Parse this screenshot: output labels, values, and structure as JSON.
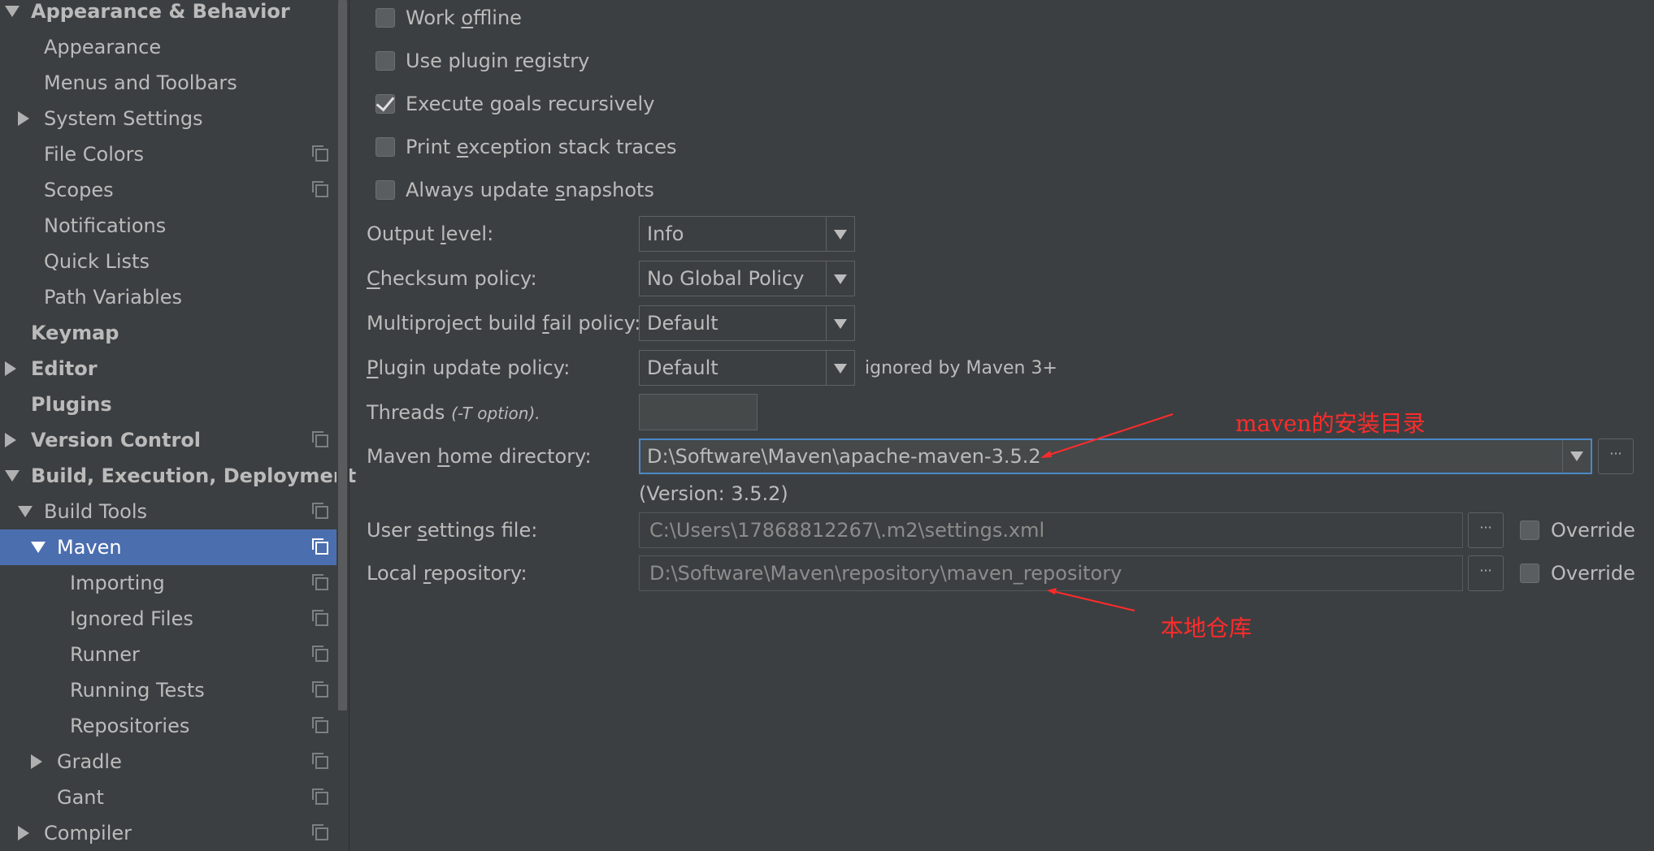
{
  "sidebar": {
    "items": [
      {
        "label": "Appearance & Behavior",
        "bold": true,
        "arrow": "down",
        "level": 0,
        "icon": false
      },
      {
        "label": "Appearance",
        "bold": false,
        "arrow": "",
        "level": 1,
        "icon": false
      },
      {
        "label": "Menus and Toolbars",
        "bold": false,
        "arrow": "",
        "level": 1,
        "icon": false
      },
      {
        "label": "System Settings",
        "bold": false,
        "arrow": "right",
        "level": 1,
        "icon": false
      },
      {
        "label": "File Colors",
        "bold": false,
        "arrow": "",
        "level": 1,
        "icon": true
      },
      {
        "label": "Scopes",
        "bold": false,
        "arrow": "",
        "level": 1,
        "icon": true
      },
      {
        "label": "Notifications",
        "bold": false,
        "arrow": "",
        "level": 1,
        "icon": false
      },
      {
        "label": "Quick Lists",
        "bold": false,
        "arrow": "",
        "level": 1,
        "icon": false
      },
      {
        "label": "Path Variables",
        "bold": false,
        "arrow": "",
        "level": 1,
        "icon": false
      },
      {
        "label": "Keymap",
        "bold": true,
        "arrow": "",
        "level": 0,
        "icon": false
      },
      {
        "label": "Editor",
        "bold": true,
        "arrow": "right",
        "level": 0,
        "icon": false
      },
      {
        "label": "Plugins",
        "bold": true,
        "arrow": "",
        "level": 0,
        "icon": false
      },
      {
        "label": "Version Control",
        "bold": true,
        "arrow": "right",
        "level": 0,
        "icon": true
      },
      {
        "label": "Build, Execution, Deployment",
        "bold": true,
        "arrow": "down",
        "level": 0,
        "icon": false
      },
      {
        "label": "Build Tools",
        "bold": false,
        "arrow": "down",
        "level": 1,
        "icon": true
      },
      {
        "label": "Maven",
        "bold": false,
        "arrow": "down",
        "level": 2,
        "icon": true,
        "selected": true
      },
      {
        "label": "Importing",
        "bold": false,
        "arrow": "",
        "level": 3,
        "icon": true
      },
      {
        "label": "Ignored Files",
        "bold": false,
        "arrow": "",
        "level": 3,
        "icon": true
      },
      {
        "label": "Runner",
        "bold": false,
        "arrow": "",
        "level": 3,
        "icon": true
      },
      {
        "label": "Running Tests",
        "bold": false,
        "arrow": "",
        "level": 3,
        "icon": true
      },
      {
        "label": "Repositories",
        "bold": false,
        "arrow": "",
        "level": 3,
        "icon": true
      },
      {
        "label": "Gradle",
        "bold": false,
        "arrow": "right",
        "level": 2,
        "icon": true
      },
      {
        "label": "Gant",
        "bold": false,
        "arrow": "",
        "level": 2,
        "icon": true
      },
      {
        "label": "Compiler",
        "bold": false,
        "arrow": "right",
        "level": 1,
        "icon": true
      }
    ]
  },
  "checkboxes": {
    "work_offline": {
      "pre": "Work ",
      "mn": "o",
      "post": "ffline",
      "checked": false
    },
    "use_plugin_registry": {
      "pre": "Use plugin ",
      "mn": "r",
      "post": "egistry",
      "checked": false
    },
    "execute_goals": {
      "pre": "Execute goals recursively",
      "mn": "",
      "post": "",
      "checked": true
    },
    "print_exception": {
      "pre": "Print ",
      "mn": "e",
      "post": "xception stack traces",
      "checked": false
    },
    "always_update": {
      "pre": "Always update ",
      "mn": "s",
      "post": "napshots",
      "checked": false
    }
  },
  "form": {
    "output_level": {
      "pre": "Output ",
      "mn": "l",
      "post": "evel:",
      "value": "Info"
    },
    "checksum_policy": {
      "pre": "",
      "mn": "C",
      "post": "hecksum policy:",
      "value": "No Global Policy"
    },
    "multiproject_policy": {
      "pre": "Multiproject build ",
      "mn": "f",
      "post": "ail policy:",
      "value": "Default"
    },
    "plugin_update_policy": {
      "pre": "",
      "mn": "P",
      "post": "lugin update policy:",
      "value": "Default",
      "note": "ignored by Maven 3+"
    },
    "threads": {
      "label": "Threads ",
      "hint": "(-T option)."
    },
    "maven_home": {
      "pre": "Maven ",
      "mn": "h",
      "post": "ome directory:",
      "value": "D:\\Software\\Maven\\apache-maven-3.5.2",
      "version": "(Version: 3.5.2)"
    },
    "user_settings": {
      "pre": "User ",
      "mn": "s",
      "post": "ettings file:",
      "value": "C:\\Users\\17868812267\\.m2\\settings.xml",
      "override": "Override"
    },
    "local_repo": {
      "pre": "Local ",
      "mn": "r",
      "post": "epository:",
      "value": "D:\\Software\\Maven\\repository\\maven_repository",
      "override": "Override"
    }
  },
  "buttons": {
    "browse": "···"
  },
  "annotations": {
    "maven_install": "maven的安装目录",
    "local_repo": "本地仓库"
  },
  "colors": {
    "background": "#3c3f41",
    "selection": "#4b6eaf",
    "focus_border": "#4a88c7",
    "annotation": "#ff2b2b"
  }
}
